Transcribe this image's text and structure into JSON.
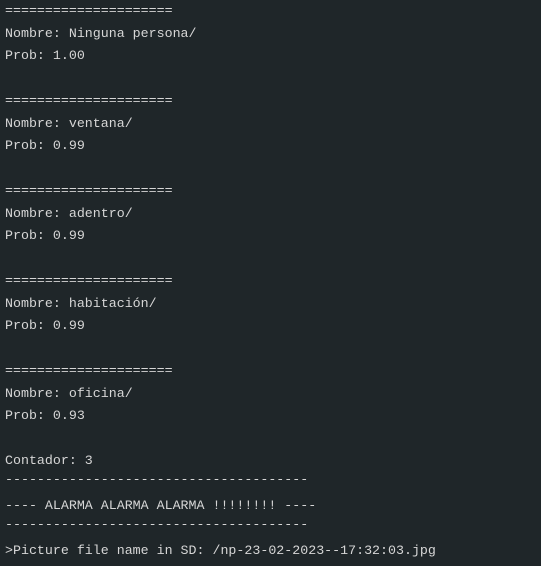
{
  "console": {
    "lines": [
      "=====================",
      "Nombre: Ninguna persona/",
      "Prob: 1.00",
      "",
      "=====================",
      "Nombre: ventana/",
      "Prob: 0.99",
      "",
      "=====================",
      "Nombre: adentro/",
      "Prob: 0.99",
      "",
      "=====================",
      "Nombre: habitación/",
      "Prob: 0.99",
      "",
      "=====================",
      "Nombre: oficina/",
      "Prob: 0.93",
      "",
      "Contador: 3",
      "--------------------------------------",
      "---- ALARMA ALARMA ALARMA !!!!!!!! ----",
      "--------------------------------------",
      ">Picture file name in SD: /np-23-02-2023--17:32:03.jpg"
    ]
  },
  "colors": {
    "background": "#1f2629",
    "text": "#d6d6d6"
  }
}
